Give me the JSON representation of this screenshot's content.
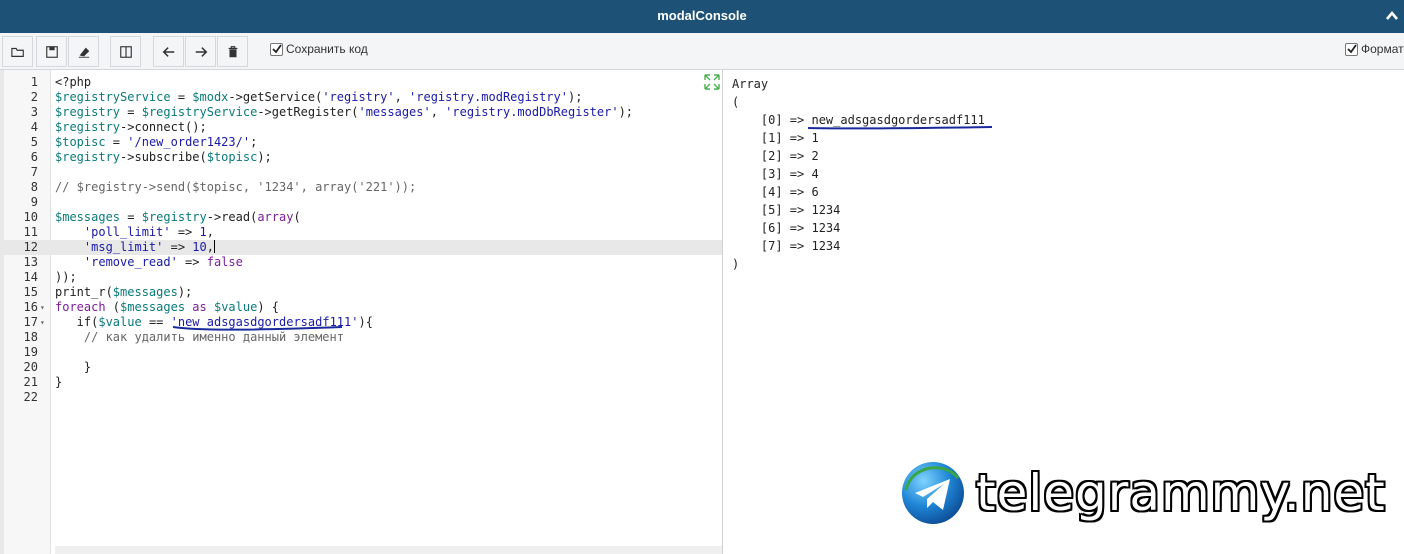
{
  "window": {
    "title": "modalConsole"
  },
  "toolbar": {
    "buttons": [
      "open-icon",
      "save-icon",
      "eraser-icon",
      "split-view-icon",
      "arrow-left-icon",
      "arrow-right-icon",
      "trash-icon"
    ],
    "save_code_label": "Сохранить код",
    "save_code_checked": true,
    "format_label": "Формат",
    "format_checked": true
  },
  "editor": {
    "active_line": 12,
    "lines": [
      "<?php",
      "$registryService = $modx->getService('registry', 'registry.modRegistry');",
      "$registry = $registryService->getRegister('messages', 'registry.modDbRegister');",
      "$registry->connect();",
      "$topisc = '/new_order1423/';",
      "$registry->subscribe($topisc);",
      "",
      "// $registry->send($topisc, '1234', array('221'));",
      "",
      "$messages = $registry->read(array(",
      "    'poll_limit' => 1,",
      "    'msg_limit' => 10,",
      "    'remove_read' => false",
      "));",
      "print_r($messages);",
      "foreach ($messages as $value) {",
      "   if($value == 'new_adsgasdgordersadf111'){",
      "    // как удалить именно данный элемент",
      "",
      "    }",
      "}",
      ""
    ]
  },
  "output": {
    "lines": [
      "Array",
      "(",
      "    [0] => new_adsgasdgordersadf111",
      "    [1] => 1",
      "    [2] => 2",
      "    [3] => 4",
      "    [4] => 6",
      "    [5] => 1234",
      "    [6] => 1234",
      "    [7] => 1234",
      ")"
    ]
  },
  "watermark": {
    "text": "telegrammy.net"
  },
  "colors": {
    "titlebar": "#1d5276",
    "annotation_ink": "#1a2a9c"
  }
}
